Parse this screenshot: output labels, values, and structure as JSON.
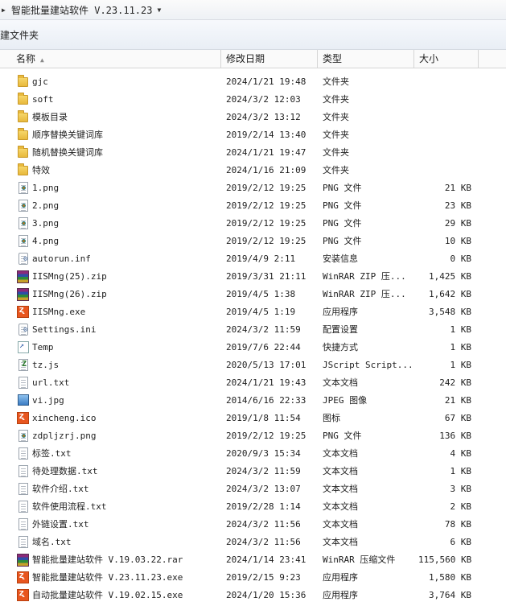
{
  "breadcrumb": {
    "path": "智能批量建站软件 V.23.11.23"
  },
  "toolbar": {
    "new_folder": "建文件夹"
  },
  "columns": {
    "name": "名称",
    "date": "修改日期",
    "type": "类型",
    "size": "大小"
  },
  "files": [
    {
      "name": "gjc",
      "date": "2024/1/21 19:48",
      "type": "文件夹",
      "size": "",
      "icon": "folder-icon"
    },
    {
      "name": "soft",
      "date": "2024/3/2 12:03",
      "type": "文件夹",
      "size": "",
      "icon": "folder-icon"
    },
    {
      "name": "模板目录",
      "date": "2024/3/2 13:12",
      "type": "文件夹",
      "size": "",
      "icon": "folder-icon"
    },
    {
      "name": "顺序替换关键词库",
      "date": "2019/2/14 13:40",
      "type": "文件夹",
      "size": "",
      "icon": "folder-icon"
    },
    {
      "name": "随机替换关键词库",
      "date": "2024/1/21 19:47",
      "type": "文件夹",
      "size": "",
      "icon": "folder-icon"
    },
    {
      "name": "特效",
      "date": "2024/1/16 21:09",
      "type": "文件夹",
      "size": "",
      "icon": "folder-icon"
    },
    {
      "name": "1.png",
      "date": "2019/2/12 19:25",
      "type": "PNG 文件",
      "size": "21 KB",
      "icon": "png-icon"
    },
    {
      "name": "2.png",
      "date": "2019/2/12 19:25",
      "type": "PNG 文件",
      "size": "23 KB",
      "icon": "png-icon"
    },
    {
      "name": "3.png",
      "date": "2019/2/12 19:25",
      "type": "PNG 文件",
      "size": "29 KB",
      "icon": "png-icon"
    },
    {
      "name": "4.png",
      "date": "2019/2/12 19:25",
      "type": "PNG 文件",
      "size": "10 KB",
      "icon": "png-icon"
    },
    {
      "name": "autorun.inf",
      "date": "2019/4/9 2:11",
      "type": "安装信息",
      "size": "0 KB",
      "icon": "settings-file-icon"
    },
    {
      "name": "IISMng(25).zip",
      "date": "2019/3/31 21:11",
      "type": "WinRAR ZIP 压...",
      "size": "1,425 KB",
      "icon": "winrar-icon"
    },
    {
      "name": "IISMng(26).zip",
      "date": "2019/4/5 1:38",
      "type": "WinRAR ZIP 压...",
      "size": "1,642 KB",
      "icon": "winrar-icon"
    },
    {
      "name": "IISMng.exe",
      "date": "2019/4/5 1:19",
      "type": "应用程序",
      "size": "3,548 KB",
      "icon": "app-icon"
    },
    {
      "name": "Settings.ini",
      "date": "2024/3/2 11:59",
      "type": "配置设置",
      "size": "1 KB",
      "icon": "settings-file-icon"
    },
    {
      "name": "Temp",
      "date": "2019/7/6 22:44",
      "type": "快捷方式",
      "size": "1 KB",
      "icon": "shortcut-icon"
    },
    {
      "name": "tz.js",
      "date": "2020/5/13 17:01",
      "type": "JScript Script...",
      "size": "1 KB",
      "icon": "script-icon"
    },
    {
      "name": "url.txt",
      "date": "2024/1/21 19:43",
      "type": "文本文档",
      "size": "242 KB",
      "icon": "text-file-icon"
    },
    {
      "name": "vi.jpg",
      "date": "2014/6/16 22:33",
      "type": "JPEG 图像",
      "size": "21 KB",
      "icon": "image-icon"
    },
    {
      "name": "xincheng.ico",
      "date": "2019/1/8 11:54",
      "type": "图标",
      "size": "67 KB",
      "icon": "app-icon"
    },
    {
      "name": "zdpljzrj.png",
      "date": "2019/2/12 19:25",
      "type": "PNG 文件",
      "size": "136 KB",
      "icon": "png-icon"
    },
    {
      "name": "标签.txt",
      "date": "2020/9/3 15:34",
      "type": "文本文档",
      "size": "4 KB",
      "icon": "text-file-icon"
    },
    {
      "name": "待处理数据.txt",
      "date": "2024/3/2 11:59",
      "type": "文本文档",
      "size": "1 KB",
      "icon": "text-file-icon"
    },
    {
      "name": "软件介绍.txt",
      "date": "2024/3/2 13:07",
      "type": "文本文档",
      "size": "3 KB",
      "icon": "text-file-icon"
    },
    {
      "name": "软件使用流程.txt",
      "date": "2019/2/28 1:14",
      "type": "文本文档",
      "size": "2 KB",
      "icon": "text-file-icon"
    },
    {
      "name": "外链设置.txt",
      "date": "2024/3/2 11:56",
      "type": "文本文档",
      "size": "78 KB",
      "icon": "text-file-icon"
    },
    {
      "name": "域名.txt",
      "date": "2024/3/2 11:56",
      "type": "文本文档",
      "size": "6 KB",
      "icon": "text-file-icon"
    },
    {
      "name": "智能批量建站软件 V.19.03.22.rar",
      "date": "2024/1/14 23:41",
      "type": "WinRAR 压缩文件",
      "size": "115,560 KB",
      "icon": "winrar-icon"
    },
    {
      "name": "智能批量建站软件 V.23.11.23.exe",
      "date": "2019/2/15 9:23",
      "type": "应用程序",
      "size": "1,580 KB",
      "icon": "app-icon"
    },
    {
      "name": "自动批量建站软件 V.19.02.15.exe",
      "date": "2024/1/20 15:36",
      "type": "应用程序",
      "size": "3,764 KB",
      "icon": "app-icon"
    }
  ]
}
